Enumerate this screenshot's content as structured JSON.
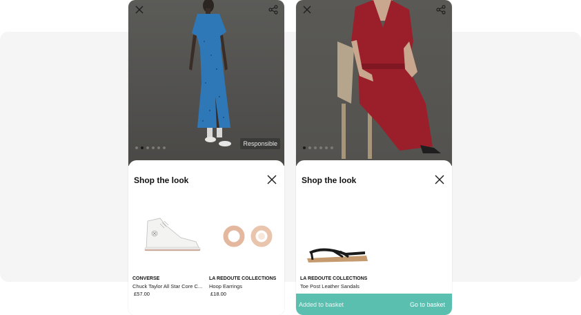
{
  "left_card": {
    "badge": "Responsible",
    "carousel": {
      "count": 6,
      "active": 1
    },
    "sheet": {
      "title": "Shop the look",
      "products": [
        {
          "brand": "CONVERSE",
          "name": "Chuck Taylor All Star Core C...",
          "price": "£57.00",
          "icon": "high-top-sneaker"
        },
        {
          "brand": "LA REDOUTE COLLECTIONS",
          "name": "Hoop Earrings",
          "price": "£18.00",
          "icon": "hoop-earrings"
        }
      ]
    }
  },
  "right_card": {
    "carousel": {
      "count": 6,
      "active": 0
    },
    "sheet": {
      "title": "Shop the look",
      "products": [
        {
          "brand": "LA REDOUTE COLLECTIONS",
          "name": "Toe Post Leather Sandals",
          "price": "",
          "icon": "sandal"
        }
      ]
    },
    "toast": {
      "message": "Added to basket",
      "action": "Go to basket"
    }
  },
  "colors": {
    "accent": "#5bbfb0",
    "dress_left": "#2f78b8",
    "dress_right": "#9a1f2a"
  }
}
